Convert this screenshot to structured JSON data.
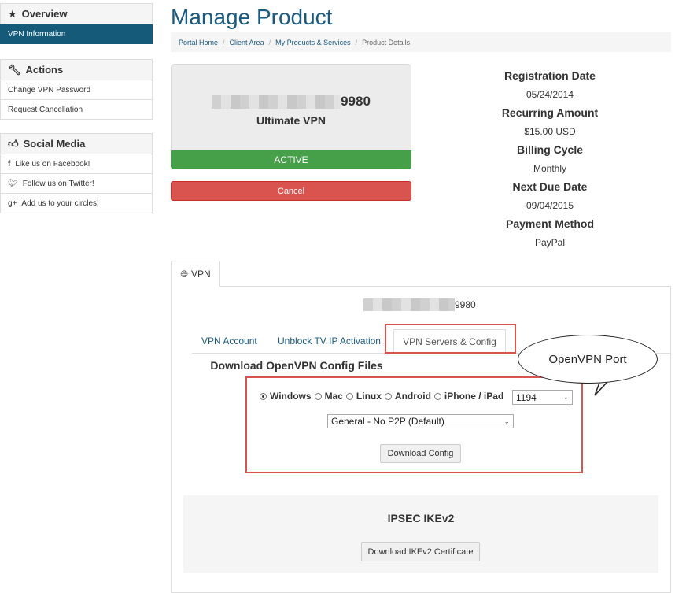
{
  "sidebar": {
    "overview": {
      "title": "Overview",
      "items": [
        "VPN Information"
      ]
    },
    "actions": {
      "title": "Actions",
      "items": [
        "Change VPN Password",
        "Request Cancellation"
      ]
    },
    "social": {
      "title": "Social Media",
      "items": [
        "Like us on Facebook!",
        "Follow us on Twitter!",
        "Add us to your circles!"
      ]
    }
  },
  "header": {
    "title": "Manage Product",
    "breadcrumb": [
      "Portal Home",
      "Client Area",
      "My Products & Services",
      "Product Details"
    ]
  },
  "product": {
    "id_suffix": "9980",
    "name": "Ultimate VPN",
    "status": "ACTIVE",
    "cancel_label": "Cancel"
  },
  "details": [
    {
      "label": "Registration Date",
      "value": "05/24/2014"
    },
    {
      "label": "Recurring Amount",
      "value": "$15.00 USD"
    },
    {
      "label": "Billing Cycle",
      "value": "Monthly"
    },
    {
      "label": "Next Due Date",
      "value": "09/04/2015"
    },
    {
      "label": "Payment Method",
      "value": "PayPal"
    }
  ],
  "tabs": {
    "main": "VPN",
    "sub": [
      "VPN Account",
      "Unblock TV IP Activation",
      "VPN Servers & Config"
    ]
  },
  "config": {
    "username_suffix": "9980",
    "heading": "Download OpenVPN Config Files",
    "platforms": [
      "Windows",
      "Mac",
      "Linux",
      "Android",
      "iPhone / iPad"
    ],
    "selected_platform": "Windows",
    "port": "1194",
    "profile": "General - No P2P (Default)",
    "download_label": "Download Config"
  },
  "ipsec": {
    "heading": "IPSEC IKEv2",
    "download_label": "Download IKEv2 Certificate"
  },
  "annotation": {
    "callout": "OpenVPN Port"
  },
  "colors": {
    "accent": "#155a78",
    "active": "#45a049",
    "danger": "#d9534f"
  }
}
